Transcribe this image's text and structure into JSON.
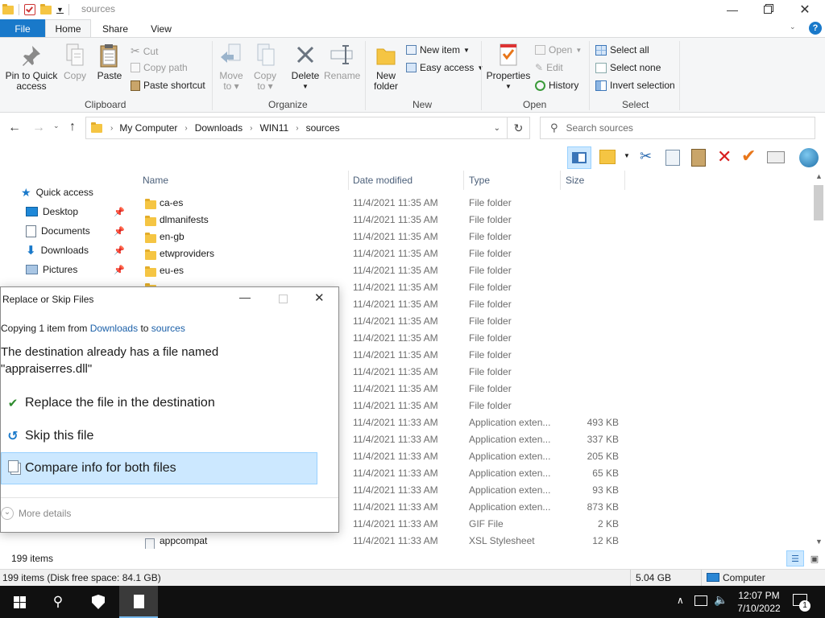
{
  "window": {
    "title": "sources"
  },
  "tabs": {
    "file": "File",
    "home": "Home",
    "share": "Share",
    "view": "View"
  },
  "ribbon": {
    "clipboard": {
      "pin": "Pin to Quick access",
      "pin_l1": "Pin to Quick",
      "pin_l2": "access",
      "copy": "Copy",
      "paste": "Paste",
      "cut": "Cut",
      "copy_path": "Copy path",
      "paste_shortcut": "Paste shortcut",
      "label": "Clipboard"
    },
    "organize": {
      "move_l1": "Move",
      "move_l2": "to",
      "copy_l1": "Copy",
      "copy_l2": "to",
      "delete": "Delete",
      "rename": "Rename",
      "label": "Organize"
    },
    "new": {
      "new_item": "New item",
      "easy_access": "Easy access",
      "folder_l1": "New",
      "folder_l2": "folder",
      "label": "New"
    },
    "open": {
      "properties": "Properties",
      "open": "Open",
      "edit": "Edit",
      "history": "History",
      "label": "Open"
    },
    "select": {
      "select_all": "Select all",
      "select_none": "Select none",
      "invert": "Invert selection",
      "label": "Select"
    }
  },
  "address": {
    "crumbs": [
      "My Computer",
      "Downloads",
      "WIN11",
      "sources"
    ],
    "search_placeholder": "Search sources"
  },
  "nav": {
    "quick_access": "Quick access",
    "items": [
      "Desktop",
      "Documents",
      "Downloads",
      "Pictures"
    ]
  },
  "columns": {
    "name": "Name",
    "date": "Date modified",
    "type": "Type",
    "size": "Size"
  },
  "files": [
    {
      "name": "ca-es",
      "date": "11/4/2021 11:35 AM",
      "type": "File folder",
      "size": ""
    },
    {
      "name": "dlmanifests",
      "date": "11/4/2021 11:35 AM",
      "type": "File folder",
      "size": ""
    },
    {
      "name": "en-gb",
      "date": "11/4/2021 11:35 AM",
      "type": "File folder",
      "size": ""
    },
    {
      "name": "etwproviders",
      "date": "11/4/2021 11:35 AM",
      "type": "File folder",
      "size": ""
    },
    {
      "name": "eu-es",
      "date": "11/4/2021 11:35 AM",
      "type": "File folder",
      "size": ""
    },
    {
      "name": "",
      "date": "11/4/2021 11:35 AM",
      "type": "File folder",
      "size": ""
    },
    {
      "name": "",
      "date": "11/4/2021 11:35 AM",
      "type": "File folder",
      "size": ""
    },
    {
      "name": "",
      "date": "11/4/2021 11:35 AM",
      "type": "File folder",
      "size": ""
    },
    {
      "name": "",
      "date": "11/4/2021 11:35 AM",
      "type": "File folder",
      "size": ""
    },
    {
      "name": "",
      "date": "11/4/2021 11:35 AM",
      "type": "File folder",
      "size": ""
    },
    {
      "name": "",
      "date": "11/4/2021 11:35 AM",
      "type": "File folder",
      "size": ""
    },
    {
      "name": "",
      "date": "11/4/2021 11:35 AM",
      "type": "File folder",
      "size": ""
    },
    {
      "name": "",
      "date": "11/4/2021 11:35 AM",
      "type": "File folder",
      "size": ""
    },
    {
      "name": "",
      "date": "11/4/2021 11:33 AM",
      "type": "Application exten...",
      "size": "493 KB"
    },
    {
      "name": "",
      "date": "11/4/2021 11:33 AM",
      "type": "Application exten...",
      "size": "337 KB"
    },
    {
      "name": "",
      "date": "11/4/2021 11:33 AM",
      "type": "Application exten...",
      "size": "205 KB"
    },
    {
      "name": "",
      "date": "11/4/2021 11:33 AM",
      "type": "Application exten...",
      "size": "65 KB"
    },
    {
      "name": "",
      "date": "11/4/2021 11:33 AM",
      "type": "Application exten...",
      "size": "93 KB"
    },
    {
      "name": "",
      "date": "11/4/2021 11:33 AM",
      "type": "Application exten...",
      "size": "873 KB"
    },
    {
      "name": "",
      "date": "11/4/2021 11:33 AM",
      "type": "GIF File",
      "size": "2 KB"
    },
    {
      "name": "appcompat",
      "date": "11/4/2021 11:33 AM",
      "type": "XSL Stylesheet",
      "size": "12 KB"
    }
  ],
  "status": {
    "count": "199 items"
  },
  "bottom": {
    "disk": "199 items (Disk free space: 84.1 GB)",
    "size": "5.04 GB",
    "location": "Computer"
  },
  "dialog": {
    "title": "Replace or Skip Files",
    "copying_prefix": "Copying 1 item from",
    "from": "Downloads",
    "to_word": "to",
    "to": "sources",
    "message_l1": "The destination already has a file named",
    "message_l2": "\"appraiserres.dll\"",
    "replace": "Replace the file in the destination",
    "skip": "Skip this file",
    "compare": "Compare info for both files",
    "more": "More details"
  },
  "taskbar": {
    "time": "12:07 PM",
    "date": "7/10/2022",
    "notif_count": "1"
  },
  "colors": {
    "accent": "#1979ca",
    "folder": "#f5c543",
    "selected": "#cce8ff",
    "taskbar": "#101010"
  }
}
